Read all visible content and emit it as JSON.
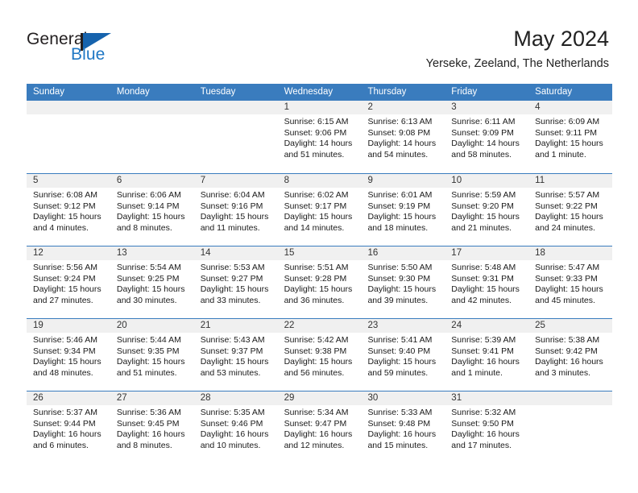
{
  "brand": {
    "name_top": "General",
    "name_bottom": "Blue",
    "accent_color": "#1663ad"
  },
  "header": {
    "title": "May 2024",
    "location": "Yerseke, Zeeland, The Netherlands"
  },
  "calendar": {
    "header_color": "#3a7cbe",
    "weekdays": [
      "Sunday",
      "Monday",
      "Tuesday",
      "Wednesday",
      "Thursday",
      "Friday",
      "Saturday"
    ],
    "weeks": [
      [
        {
          "day": "",
          "empty": true,
          "lines": []
        },
        {
          "day": "",
          "empty": true,
          "lines": []
        },
        {
          "day": "",
          "empty": true,
          "lines": []
        },
        {
          "day": "1",
          "empty": false,
          "lines": [
            "Sunrise: 6:15 AM",
            "Sunset: 9:06 PM",
            "Daylight: 14 hours",
            "and 51 minutes."
          ]
        },
        {
          "day": "2",
          "empty": false,
          "lines": [
            "Sunrise: 6:13 AM",
            "Sunset: 9:08 PM",
            "Daylight: 14 hours",
            "and 54 minutes."
          ]
        },
        {
          "day": "3",
          "empty": false,
          "lines": [
            "Sunrise: 6:11 AM",
            "Sunset: 9:09 PM",
            "Daylight: 14 hours",
            "and 58 minutes."
          ]
        },
        {
          "day": "4",
          "empty": false,
          "lines": [
            "Sunrise: 6:09 AM",
            "Sunset: 9:11 PM",
            "Daylight: 15 hours",
            "and 1 minute."
          ]
        }
      ],
      [
        {
          "day": "5",
          "empty": false,
          "lines": [
            "Sunrise: 6:08 AM",
            "Sunset: 9:12 PM",
            "Daylight: 15 hours",
            "and 4 minutes."
          ]
        },
        {
          "day": "6",
          "empty": false,
          "lines": [
            "Sunrise: 6:06 AM",
            "Sunset: 9:14 PM",
            "Daylight: 15 hours",
            "and 8 minutes."
          ]
        },
        {
          "day": "7",
          "empty": false,
          "lines": [
            "Sunrise: 6:04 AM",
            "Sunset: 9:16 PM",
            "Daylight: 15 hours",
            "and 11 minutes."
          ]
        },
        {
          "day": "8",
          "empty": false,
          "lines": [
            "Sunrise: 6:02 AM",
            "Sunset: 9:17 PM",
            "Daylight: 15 hours",
            "and 14 minutes."
          ]
        },
        {
          "day": "9",
          "empty": false,
          "lines": [
            "Sunrise: 6:01 AM",
            "Sunset: 9:19 PM",
            "Daylight: 15 hours",
            "and 18 minutes."
          ]
        },
        {
          "day": "10",
          "empty": false,
          "lines": [
            "Sunrise: 5:59 AM",
            "Sunset: 9:20 PM",
            "Daylight: 15 hours",
            "and 21 minutes."
          ]
        },
        {
          "day": "11",
          "empty": false,
          "lines": [
            "Sunrise: 5:57 AM",
            "Sunset: 9:22 PM",
            "Daylight: 15 hours",
            "and 24 minutes."
          ]
        }
      ],
      [
        {
          "day": "12",
          "empty": false,
          "lines": [
            "Sunrise: 5:56 AM",
            "Sunset: 9:24 PM",
            "Daylight: 15 hours",
            "and 27 minutes."
          ]
        },
        {
          "day": "13",
          "empty": false,
          "lines": [
            "Sunrise: 5:54 AM",
            "Sunset: 9:25 PM",
            "Daylight: 15 hours",
            "and 30 minutes."
          ]
        },
        {
          "day": "14",
          "empty": false,
          "lines": [
            "Sunrise: 5:53 AM",
            "Sunset: 9:27 PM",
            "Daylight: 15 hours",
            "and 33 minutes."
          ]
        },
        {
          "day": "15",
          "empty": false,
          "lines": [
            "Sunrise: 5:51 AM",
            "Sunset: 9:28 PM",
            "Daylight: 15 hours",
            "and 36 minutes."
          ]
        },
        {
          "day": "16",
          "empty": false,
          "lines": [
            "Sunrise: 5:50 AM",
            "Sunset: 9:30 PM",
            "Daylight: 15 hours",
            "and 39 minutes."
          ]
        },
        {
          "day": "17",
          "empty": false,
          "lines": [
            "Sunrise: 5:48 AM",
            "Sunset: 9:31 PM",
            "Daylight: 15 hours",
            "and 42 minutes."
          ]
        },
        {
          "day": "18",
          "empty": false,
          "lines": [
            "Sunrise: 5:47 AM",
            "Sunset: 9:33 PM",
            "Daylight: 15 hours",
            "and 45 minutes."
          ]
        }
      ],
      [
        {
          "day": "19",
          "empty": false,
          "lines": [
            "Sunrise: 5:46 AM",
            "Sunset: 9:34 PM",
            "Daylight: 15 hours",
            "and 48 minutes."
          ]
        },
        {
          "day": "20",
          "empty": false,
          "lines": [
            "Sunrise: 5:44 AM",
            "Sunset: 9:35 PM",
            "Daylight: 15 hours",
            "and 51 minutes."
          ]
        },
        {
          "day": "21",
          "empty": false,
          "lines": [
            "Sunrise: 5:43 AM",
            "Sunset: 9:37 PM",
            "Daylight: 15 hours",
            "and 53 minutes."
          ]
        },
        {
          "day": "22",
          "empty": false,
          "lines": [
            "Sunrise: 5:42 AM",
            "Sunset: 9:38 PM",
            "Daylight: 15 hours",
            "and 56 minutes."
          ]
        },
        {
          "day": "23",
          "empty": false,
          "lines": [
            "Sunrise: 5:41 AM",
            "Sunset: 9:40 PM",
            "Daylight: 15 hours",
            "and 59 minutes."
          ]
        },
        {
          "day": "24",
          "empty": false,
          "lines": [
            "Sunrise: 5:39 AM",
            "Sunset: 9:41 PM",
            "Daylight: 16 hours",
            "and 1 minute."
          ]
        },
        {
          "day": "25",
          "empty": false,
          "lines": [
            "Sunrise: 5:38 AM",
            "Sunset: 9:42 PM",
            "Daylight: 16 hours",
            "and 3 minutes."
          ]
        }
      ],
      [
        {
          "day": "26",
          "empty": false,
          "lines": [
            "Sunrise: 5:37 AM",
            "Sunset: 9:44 PM",
            "Daylight: 16 hours",
            "and 6 minutes."
          ]
        },
        {
          "day": "27",
          "empty": false,
          "lines": [
            "Sunrise: 5:36 AM",
            "Sunset: 9:45 PM",
            "Daylight: 16 hours",
            "and 8 minutes."
          ]
        },
        {
          "day": "28",
          "empty": false,
          "lines": [
            "Sunrise: 5:35 AM",
            "Sunset: 9:46 PM",
            "Daylight: 16 hours",
            "and 10 minutes."
          ]
        },
        {
          "day": "29",
          "empty": false,
          "lines": [
            "Sunrise: 5:34 AM",
            "Sunset: 9:47 PM",
            "Daylight: 16 hours",
            "and 12 minutes."
          ]
        },
        {
          "day": "30",
          "empty": false,
          "lines": [
            "Sunrise: 5:33 AM",
            "Sunset: 9:48 PM",
            "Daylight: 16 hours",
            "and 15 minutes."
          ]
        },
        {
          "day": "31",
          "empty": false,
          "lines": [
            "Sunrise: 5:32 AM",
            "Sunset: 9:50 PM",
            "Daylight: 16 hours",
            "and 17 minutes."
          ]
        },
        {
          "day": "",
          "empty": true,
          "lines": []
        }
      ]
    ]
  }
}
